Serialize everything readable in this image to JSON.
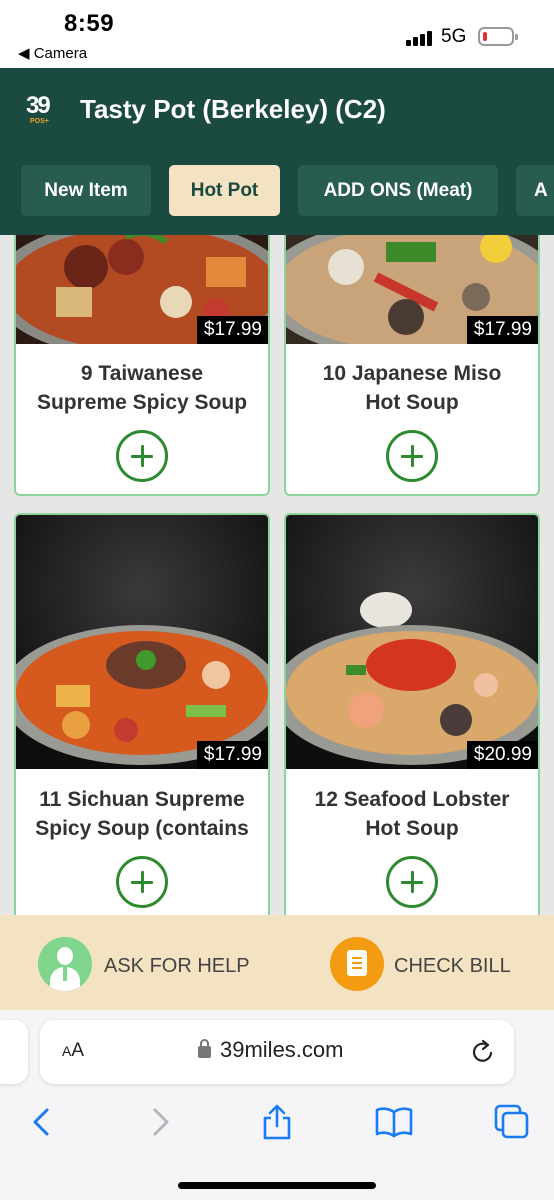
{
  "status_bar": {
    "time": "8:59",
    "back_label": "◀ Camera",
    "network": "5G"
  },
  "header": {
    "logo_text": "39",
    "logo_sub": "POS+",
    "title": "Tasty Pot (Berkeley) (C2)",
    "tabs": [
      {
        "label": "New Item",
        "active": false
      },
      {
        "label": "Hot Pot",
        "active": true
      },
      {
        "label": "ADD ONS (Meat)",
        "active": false
      },
      {
        "label": "A",
        "active": false
      }
    ]
  },
  "menu_items": [
    {
      "name_line1": "9 Taiwanese",
      "name_line2": "Supreme Spicy Soup",
      "price": "$17.99"
    },
    {
      "name_line1": "10 Japanese Miso",
      "name_line2": "Hot Soup",
      "price": "$17.99"
    },
    {
      "name_line1": "11 Sichuan Supreme",
      "name_line2": "Spicy Soup (contains",
      "price": "$17.99"
    },
    {
      "name_line1": "12 Seafood Lobster",
      "name_line2": "Hot Soup",
      "price": "$20.99"
    }
  ],
  "action_bar": {
    "help_label": "ASK FOR HELP",
    "bill_label": "CHECK BILL"
  },
  "browser": {
    "aa_big": "A",
    "aa_small": "A",
    "url": "39miles.com"
  },
  "colors": {
    "header_bg": "#1b4a40",
    "tab_bg": "#285c51",
    "tab_active_bg": "#f4e3c3",
    "card_border": "#8fd39c",
    "add_button": "#2e8a2e",
    "action_bar_bg": "#f4e3c3",
    "ios_blue": "#1a7cf5"
  }
}
